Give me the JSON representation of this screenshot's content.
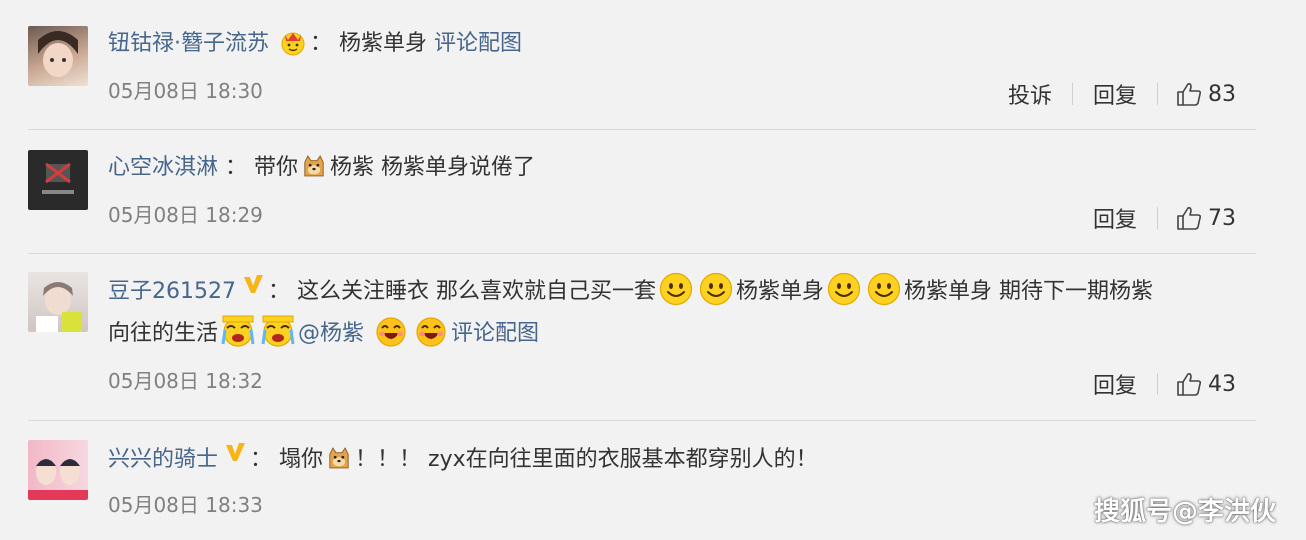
{
  "comments": [
    {
      "username": "钮钴禄·簪子流苏",
      "badge_icon": "crown-emoji-icon",
      "sep": "：",
      "segments": [
        "杨紫单身"
      ],
      "link": "评论配图",
      "time": "05月08日 18:30",
      "report_label": "投诉",
      "reply_label": "回复",
      "likes": "83"
    },
    {
      "username": "心空冰淇淋",
      "sep": "：",
      "segments": [
        "带你",
        "杨紫 杨紫单身说倦了"
      ],
      "time": "05月08日 18:29",
      "reply_label": "回复",
      "likes": "73"
    },
    {
      "username": "豆子261527",
      "badge_icon": "v-badge-icon",
      "sep": "：",
      "segments": [
        "这么关注睡衣 那么喜欢就自己买一套",
        "杨紫单身",
        "杨紫单身 期待下一期杨紫",
        "向往的生活",
        "@杨紫"
      ],
      "link": "评论配图",
      "time": "05月08日 18:32",
      "reply_label": "回复",
      "likes": "43"
    },
    {
      "username": "兴兴的骑士",
      "badge_icon": "v-badge-icon",
      "sep": "：",
      "segments": [
        "塌你",
        "！！！ zyx在向往里面的衣服基本都穿别人的！"
      ],
      "time": "05月08日 18:33"
    }
  ],
  "watermark": "搜狐号@李洪伙",
  "colors": {
    "username": "#46668b",
    "text": "#333333",
    "time": "#808080",
    "background": "#f2f2f2"
  }
}
